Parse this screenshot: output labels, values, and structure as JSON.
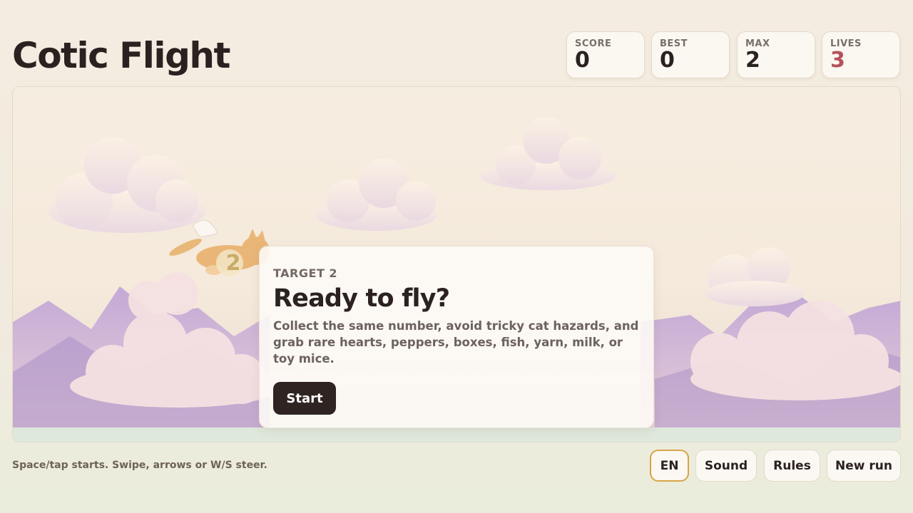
{
  "app": {
    "title": "Cotic Flight"
  },
  "stats": [
    {
      "label": "SCORE",
      "value": "0"
    },
    {
      "label": "BEST",
      "value": "0"
    },
    {
      "label": "MAX",
      "value": "2"
    },
    {
      "label": "LIVES",
      "value": "3"
    }
  ],
  "player": {
    "number": "2"
  },
  "card": {
    "target": "TARGET 2",
    "heading": "Ready to fly?",
    "body": "Collect the same number, avoid tricky cat hazards, and grab rare hearts, peppers, boxes, fish, yarn, milk, or toy mice.",
    "start_label": "Start"
  },
  "footer": {
    "hint": "Space/tap starts. Swipe, arrows or W/S steer.",
    "buttons": [
      "EN",
      "Sound",
      "Rules",
      "New run"
    ]
  },
  "colors": {
    "lives": "#b5525c",
    "active_border": "#d6a544",
    "dark_button": "#2f2422"
  }
}
